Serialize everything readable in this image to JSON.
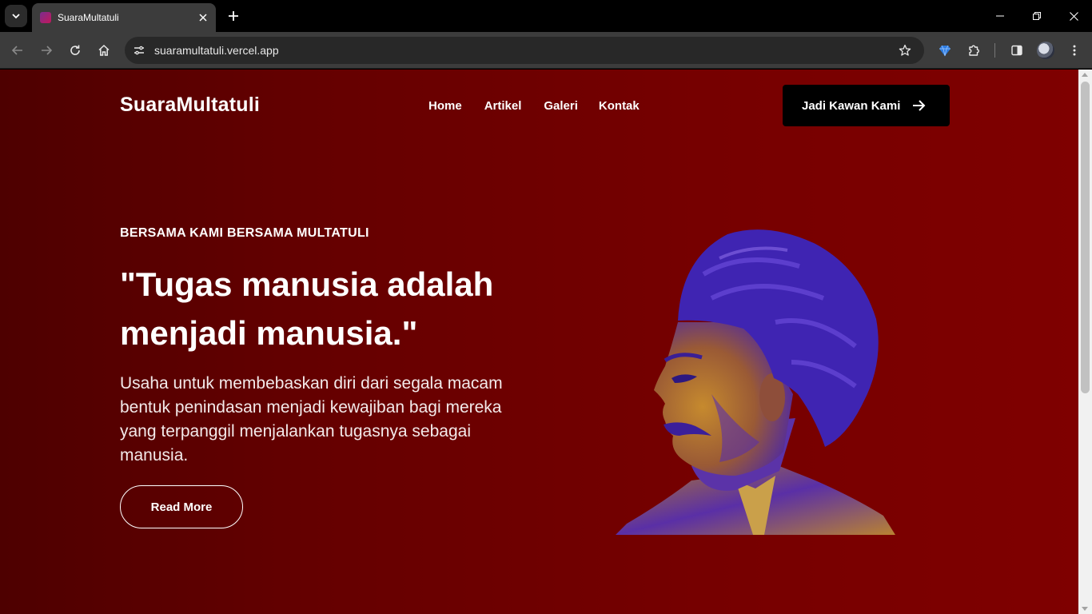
{
  "browser": {
    "tab_title": "SuaraMultatuli",
    "url": "suaramultatuli.vercel.app"
  },
  "site": {
    "brand": "SuaraMultatuli",
    "nav": [
      "Home",
      "Artikel",
      "Galeri",
      "Kontak"
    ],
    "cta_label": "Jadi Kawan Kami"
  },
  "hero": {
    "eyebrow": "BERSAMA KAMI BERSAMA MULTATULI",
    "headline": "\"Tugas manusia adalah menjadi manusia.\"",
    "description": "Usaha untuk membebaskan diri dari segala macam bentuk penindasan menjadi kewajiban bagi mereka yang terpanggil menjalankan tugasnya sebagai manusia.",
    "read_more": "Read More"
  },
  "colors": {
    "page_bg_start": "#4e0000",
    "page_bg_end": "#7f0000",
    "cta_bg": "#000000",
    "portrait_blue": "#3b1fb0",
    "portrait_gold": "#b87a2a"
  },
  "icons": {
    "tab_search": "chevron-down-icon",
    "tab_close": "close-icon",
    "new_tab": "plus-icon",
    "back": "arrow-left-icon",
    "forward": "arrow-right-icon",
    "reload": "reload-icon",
    "home": "home-icon",
    "site_info": "tune-icon",
    "bookmark": "star-icon",
    "extension_gem": "gem-icon",
    "extensions": "puzzle-icon",
    "side_panel": "side-panel-icon",
    "menu": "kebab-icon",
    "cta_arrow": "arrow-right-icon"
  }
}
